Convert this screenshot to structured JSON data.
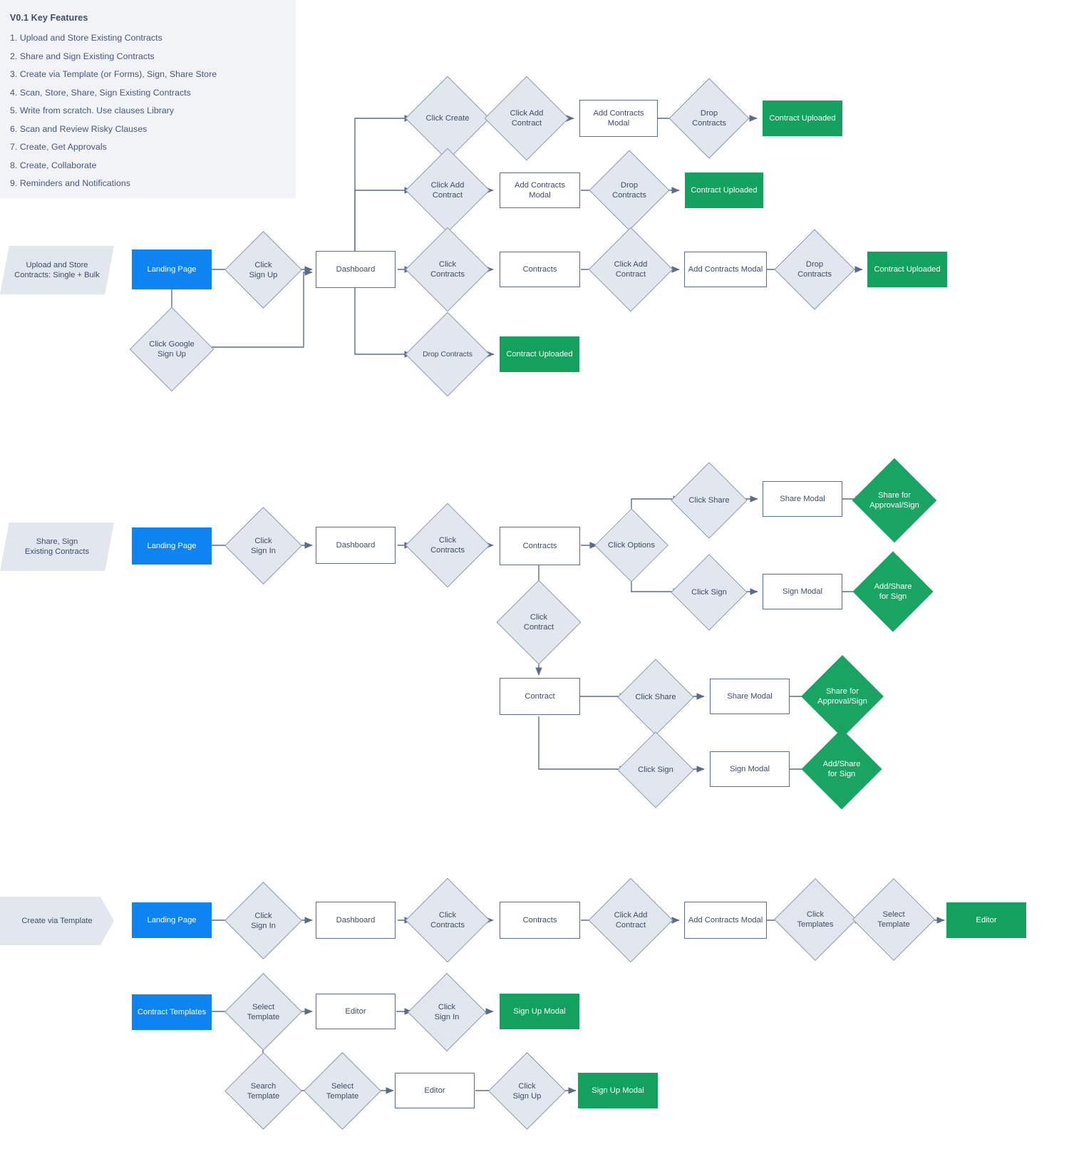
{
  "features": {
    "title": "V0.1 Key Features",
    "items": [
      "1. Upload and Store Existing Contracts",
      "2. Share and Sign Existing Contracts",
      "3. Create via Template (or Forms), Sign, Share Store",
      "4. Scan, Store, Share, Sign Existing Contracts",
      "5. Write from scratch. Use clauses Library",
      "6. Scan and Review Risky Clauses",
      "7. Create, Get Approvals",
      "8. Create, Collaborate",
      "9. Reminders and Notifications"
    ]
  },
  "colors": {
    "blue": "#0d84f2",
    "green": "#14a05e",
    "green_diamond": "#1aa463",
    "gray_fill": "#e2e6ee",
    "stroke": "#5a6c8c",
    "text": "#3d4d66",
    "panel_bg": "#f1f3f7"
  },
  "flows": [
    {
      "id": "flow-1",
      "start_label": "Upload and Store\nContracts: Single + Bulk",
      "nodes": {
        "landing_page": "Landing Page",
        "click_sign_up": "Click\nSign Up",
        "click_google_sign_up": "Click Google\nSign Up",
        "dashboard": "Dashboard",
        "branch_a_click_create": "Click Create",
        "branch_a_click_add_contract": "Click Add\nContract",
        "branch_a_add_contracts_modal": "Add Contracts Modal",
        "branch_a_drop_contracts": "Drop\nContracts",
        "branch_a_contract_uploaded": "Contract Uploaded",
        "branch_b_click_add_contract": "Click Add\nContract",
        "branch_b_add_contracts_modal": "Add Contracts Modal",
        "branch_b_drop_contracts": "Drop\nContracts",
        "branch_b_contract_uploaded": "Contract Uploaded",
        "branch_c_click_contracts": "Click\nContracts",
        "branch_c_contracts": "Contracts",
        "branch_c_click_add_contract": "Click Add\nContract",
        "branch_c_add_contracts_modal": "Add Contracts Modal",
        "branch_c_drop_contracts": "Drop\nContracts",
        "branch_c_contract_uploaded": "Contract Uploaded",
        "branch_d_drop_contracts": "Drop Contracts",
        "branch_d_contract_uploaded": "Contract Uploaded"
      }
    },
    {
      "id": "flow-2",
      "start_label": "Share, Sign\nExisting Contracts",
      "nodes": {
        "landing_page": "Landing Page",
        "click_sign_in": "Click\nSign In",
        "dashboard": "Dashboard",
        "click_contracts": "Click\nContracts",
        "contracts": "Contracts",
        "click_options": "Click Options",
        "opt_click_share": "Click Share",
        "opt_share_modal": "Share Modal",
        "opt_share_result": "Share for\nApproval/Sign",
        "opt_click_sign": "Click Sign",
        "opt_sign_modal": "Sign Modal",
        "opt_sign_result": "Add/Share\nfor Sign",
        "click_contract": "Click\nContract",
        "contract": "Contract",
        "c_click_share": "Click Share",
        "c_share_modal": "Share Modal",
        "c_share_result": "Share for\nApproval/Sign",
        "c_click_sign": "Click Sign",
        "c_sign_modal": "Sign Modal",
        "c_sign_result": "Add/Share\nfor Sign"
      }
    },
    {
      "id": "flow-3",
      "start_label": "Create via Template",
      "nodes": {
        "landing_page": "Landing Page",
        "click_sign_in": "Click\nSign In",
        "dashboard": "Dashboard",
        "click_contracts": "Click\nContracts",
        "contracts": "Contracts",
        "click_add_contract": "Click Add\nContract",
        "add_contracts_modal": "Add Contracts Modal",
        "click_templates": "Click\nTemplates",
        "select_template": "Select\nTemplate",
        "editor": "Editor",
        "contract_templates": "Contract Templates",
        "t_select_template": "Select\nTemplate",
        "t_editor": "Editor",
        "t_click_sign_in": "Click\nSign In",
        "t_sign_up_modal": "Sign Up Modal",
        "s_search_template": "Search\nTemplate",
        "s_select_template": "Select\nTemplate",
        "s_editor": "Editor",
        "s_click_sign_up": "Click\nSign Up",
        "s_sign_up_modal": "Sign Up Modal"
      }
    }
  ]
}
